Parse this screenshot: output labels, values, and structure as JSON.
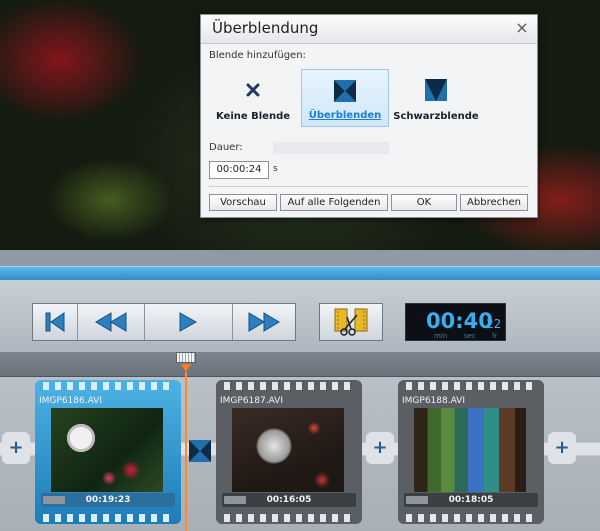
{
  "dialog": {
    "title": "Überblendung",
    "close_glyph": "×",
    "blend_label": "Blende hinzufügen:",
    "options": [
      {
        "label": "Keine Blende",
        "icon": "x-icon",
        "selected": false
      },
      {
        "label": "Überblenden",
        "icon": "crossfade-icon",
        "selected": true
      },
      {
        "label": "Schwarzblende",
        "icon": "fade-to-black-icon",
        "selected": false
      }
    ],
    "duration_label": "Dauer:",
    "duration_value": "00:00:24",
    "duration_unit": "s",
    "buttons": {
      "preview": "Vorschau",
      "apply_all": "Auf alle Folgenden",
      "ok": "OK",
      "cancel": "Abbrechen"
    }
  },
  "timecode": {
    "main": "00:40",
    "frames": "22",
    "units": {
      "min": "min",
      "sec": "sec",
      "fr": "fr"
    }
  },
  "clips": [
    {
      "name": "IMGP6186.AVI",
      "duration": "00:19:23",
      "active": true
    },
    {
      "name": "IMGP6187.AVI",
      "duration": "00:16:05",
      "active": false
    },
    {
      "name": "IMGP6188.AVI",
      "duration": "00:18:05",
      "active": false
    }
  ],
  "storyboard": {
    "add_glyph": "+"
  },
  "colors": {
    "accent_blue": "#2a8ac8",
    "timecode_blue": "#38aef0",
    "playhead_orange": "#ff7a1a",
    "crossfade_icon": "#1e6fae"
  }
}
